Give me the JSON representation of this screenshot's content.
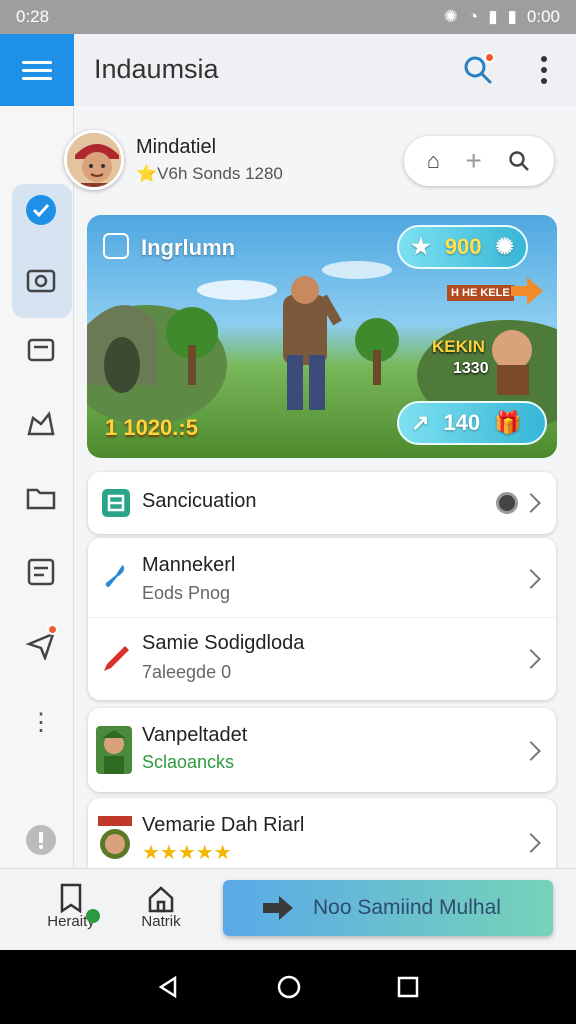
{
  "status_bar": {
    "time": "0:28",
    "clock": "0:00"
  },
  "app_bar": {
    "title": "Indaumsia"
  },
  "profile": {
    "name": "Mindatiel",
    "subtitle": "⭐V6h Sonds 1280"
  },
  "banner": {
    "title": "Ingrlumn",
    "coins": "900",
    "score": "1 1020.:5",
    "hero_label": "KEKIN",
    "hero_number": "1330",
    "level_tag": "H HE KELE",
    "pill_bottom": "140"
  },
  "list": {
    "header_item": "Sancicuation",
    "items": [
      {
        "title": "Mannekerl",
        "subtitle": "Eods Pnog"
      },
      {
        "title": "Samie Sodigdloda",
        "subtitle": "7aleegde 0"
      }
    ],
    "games": [
      {
        "title": "Vanpeltadet",
        "subtitle": "Sclaoancks"
      },
      {
        "title": "Vemarie Dah Riarl",
        "subtitle": "★★★★★"
      }
    ]
  },
  "bottom_bar": {
    "tab1": "Heraity",
    "tab2": "Natrik",
    "cta": "Noo Samiind Mulhal"
  },
  "colors": {
    "accent": "#1e90e8",
    "notification": "#ef5a2f",
    "green": "#2e9a3f"
  }
}
